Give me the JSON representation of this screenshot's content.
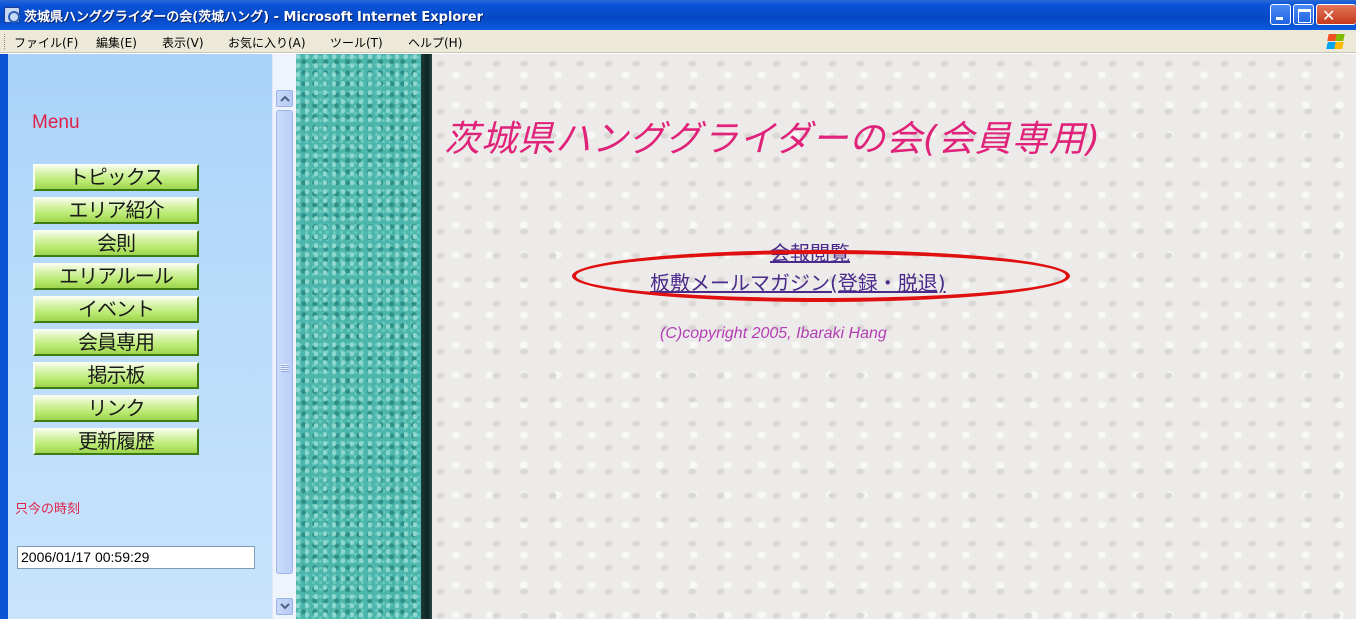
{
  "window": {
    "title": "茨城県ハンググライダーの会(茨城ハング) - Microsoft Internet Explorer",
    "app_icon": "ie-page-icon",
    "controls": [
      "minimize",
      "maximize",
      "close"
    ]
  },
  "menubar": {
    "items": [
      {
        "label": "ファイル(F)"
      },
      {
        "label": "編集(E)"
      },
      {
        "label": "表示(V)"
      },
      {
        "label": "お気に入り(A)"
      },
      {
        "label": "ツール(T)"
      },
      {
        "label": "ヘルプ(H)"
      }
    ],
    "logo": "windows-flag-icon"
  },
  "sidebar": {
    "heading": "Menu",
    "nav": [
      {
        "label": "トピックス"
      },
      {
        "label": "エリア紹介"
      },
      {
        "label": "会則"
      },
      {
        "label": "エリアルール"
      },
      {
        "label": "イベント"
      },
      {
        "label": "会員専用"
      },
      {
        "label": "掲示板"
      },
      {
        "label": "リンク"
      },
      {
        "label": "更新履歴"
      }
    ],
    "clock_label": "只今の時刻",
    "clock_value": "2006/01/17 00:59:29"
  },
  "main": {
    "title": "茨城県ハンググライダーの会(会員専用)",
    "links": [
      {
        "label": "会報閲覧"
      },
      {
        "label": "板敷メールマガジン(登録・脱退)"
      }
    ],
    "copyright": "(C)copyright 2005, Ibaraki Hang"
  },
  "colors": {
    "menu_heading": "#e0224a",
    "page_title": "#e0227a",
    "link": "#4a2a8a",
    "copyright": "#b43cb4",
    "highlight_oval": "#e01010",
    "nav_button": "#b6e86c",
    "teal_strip": "#4cb6ad"
  }
}
